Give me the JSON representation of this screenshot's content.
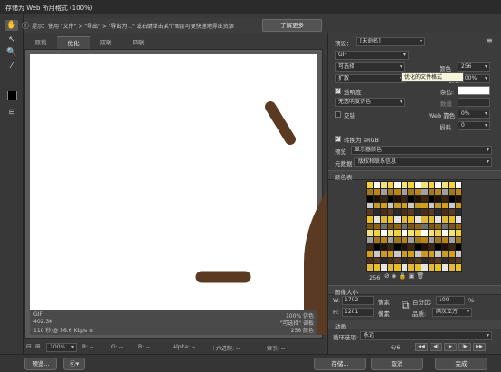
{
  "window": {
    "title": "存储为 Web 所用格式 (100%)"
  },
  "hint": {
    "text": "提示：使用 \"文件\" > \"导出\" > \"导出为...\" 或右键单击某个图层可更快速地导出资源",
    "learn_more": "了解更多"
  },
  "tabs": [
    "原稿",
    "优化",
    "双联",
    "四联"
  ],
  "preview_info": {
    "left_lines": [
      "GIF",
      "402.3K",
      "110 秒 @ 56.6 Kbps  ≡"
    ],
    "right_lines": [
      "100% 仿色",
      "\"可选择\" 调板",
      "256 颜色"
    ]
  },
  "status": {
    "zoom": "100%",
    "r": "R: --",
    "g": "G: --",
    "b": "B: --",
    "alpha": "Alpha: --",
    "hex": "十六进制: --",
    "index": "索引: --"
  },
  "bottom": {
    "preview_label": "预览...",
    "save_label": "存储...",
    "cancel_label": "取消",
    "done_label": "完成"
  },
  "right_panel": {
    "preset_label": "预设：",
    "preset_value": "[未命名]",
    "format_value": "GIF",
    "reduction_value": "可选择",
    "dither_algo": "扩散",
    "colors_label": "颜色",
    "colors_value": "256",
    "dither_label": "仿色",
    "dither_value": "100%",
    "transparency_label": "透明度",
    "matte_label": "杂边:",
    "trans_dither_value": "无透明度仿色",
    "amount_label": "数量",
    "interlaced_label": "交错",
    "web_snap_label": "Web 靠色",
    "web_snap_value": "0%",
    "lossy_label": "损耗",
    "lossy_value": "0",
    "convert_srgb_label": "转换为 sRGB",
    "preview_label": "预览",
    "preview_value": "显示器颜色",
    "metadata_label": "元数据",
    "metadata_value": "版权和联系信息",
    "color_table_label": "颜色表",
    "color_count": "256",
    "image_size_label": "图像大小",
    "w_label": "W:",
    "w_value": "1702",
    "h_label": "H:",
    "h_value": "1201",
    "px": "像素",
    "percent_label": "百分比:",
    "percent_value": "100",
    "percent_unit": "%",
    "quality_label": "品质:",
    "quality_value": "两次立方",
    "animation_label": "动画",
    "loop_label": "循环选项:",
    "loop_value": "永远",
    "frame_counter": "6/6"
  },
  "tooltip": "优化的文件格式",
  "colors": {
    "artwork_brown": "#5a3a22",
    "canvas_white": "#ffffff"
  },
  "palette_colors": [
    "#f5d23a",
    "#e8c020",
    "#d4a01a",
    "#b88616",
    "#8c6414",
    "#5a3a22",
    "#3a2412",
    "#ffffff",
    "#e6e6e6",
    "#c9c9c9",
    "#a0a0a0",
    "#6f6f6f",
    "#2b2b2b",
    "#000000",
    "#f2e27a",
    "#e0b840",
    "#c89a28",
    "#a0781c",
    "#7a5418",
    "#4c2e18",
    "#201008"
  ]
}
